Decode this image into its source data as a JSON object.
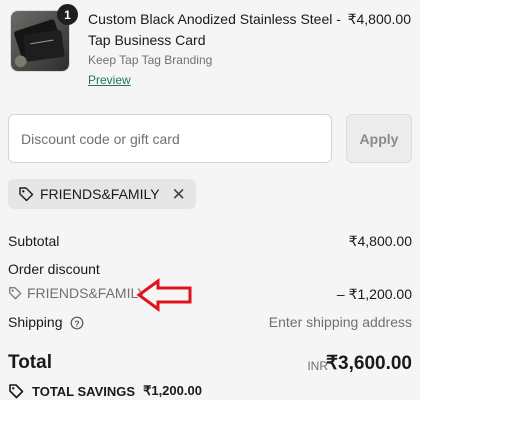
{
  "product": {
    "quantity": "1",
    "name": "Custom Black Anodized Stainless Steel - Tap Business Card",
    "variant": "Keep Tap Tag Branding",
    "preview_link": "Preview",
    "price": "₹4,800.00"
  },
  "discount": {
    "placeholder": "Discount code or gift card",
    "value": "",
    "apply_label": "Apply"
  },
  "applied_code": {
    "label": "FRIENDS&FAMILY"
  },
  "summary": {
    "subtotal_label": "Subtotal",
    "subtotal_value": "₹4,800.00",
    "order_discount_label": "Order discount",
    "discount_code": "FRIENDS&FAMILY",
    "discount_value": "– ₹1,200.00",
    "shipping_label": "Shipping",
    "shipping_value": "Enter shipping address"
  },
  "total": {
    "label": "Total",
    "currency": "INR",
    "value": "₹3,600.00",
    "savings_label": "TOTAL SAVINGS",
    "savings_value": "₹1,200.00"
  },
  "colors": {
    "panel_bg": "#f5f5f5",
    "link_green": "#1f7a52",
    "annotation_red": "#e0121b"
  },
  "icons": {
    "tag": "tag-icon",
    "close": "close-icon",
    "info": "info-icon",
    "arrow": "red-arrow-left"
  }
}
